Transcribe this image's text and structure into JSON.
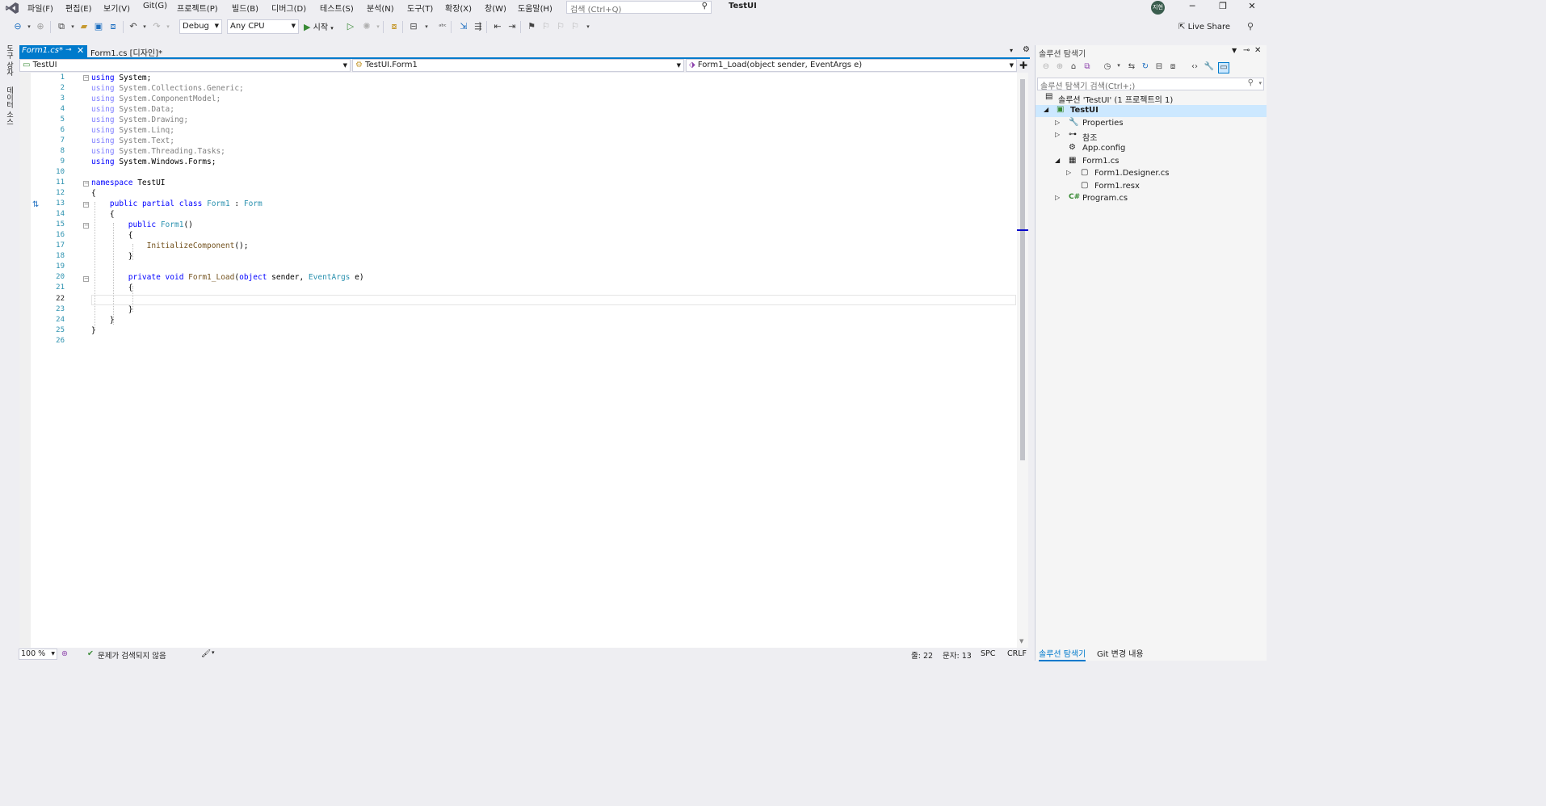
{
  "menubar": {
    "items": [
      "파일(F)",
      "편집(E)",
      "보기(V)",
      "Git(G)",
      "프로젝트(P)",
      "빌드(B)",
      "디버그(D)",
      "테스트(S)",
      "분석(N)",
      "도구(T)",
      "확장(X)",
      "창(W)",
      "도움말(H)"
    ],
    "search_placeholder": "검색 (Ctrl+Q)",
    "window_title": "TestUI",
    "avatar_initials": "지현"
  },
  "toolbar": {
    "config": "Debug",
    "platform": "Any CPU",
    "start_label": "시작",
    "live_share": "Live Share"
  },
  "left_strip": {
    "toolbox": "도구 상자",
    "datasource": "데이터 소스"
  },
  "tabs": [
    {
      "label": "Form1.cs*",
      "active": true
    },
    {
      "label": "Form1.cs [디자인]*",
      "active": false
    }
  ],
  "navbar": {
    "project": "TestUI",
    "type": "TestUI.Form1",
    "member": "Form1_Load(object sender, EventArgs e)"
  },
  "editor": {
    "current_line": 22,
    "line_numbers": [
      "1",
      "2",
      "3",
      "4",
      "5",
      "6",
      "7",
      "8",
      "9",
      "10",
      "11",
      "12",
      "13",
      "14",
      "15",
      "16",
      "17",
      "18",
      "19",
      "20",
      "21",
      "22",
      "23",
      "24",
      "25",
      "26"
    ],
    "lines": [
      "using System;",
      "using System.Collections.Generic;",
      "using System.ComponentModel;",
      "using System.Data;",
      "using System.Drawing;",
      "using System.Linq;",
      "using System.Text;",
      "using System.Threading.Tasks;",
      "using System.Windows.Forms;",
      "",
      "namespace TestUI",
      "{",
      "    public partial class Form1 : Form",
      "    {",
      "        public Form1()",
      "        {",
      "            InitializeComponent();",
      "        }",
      "",
      "        private void Form1_Load(object sender, EventArgs e)",
      "        {",
      "",
      "        }",
      "    }",
      "}",
      ""
    ]
  },
  "statusbar": {
    "zoom": "100 %",
    "issues": "문제가 검색되지 않음",
    "line": "줄: 22",
    "col": "문자: 13",
    "spc": "SPC",
    "eol": "CRLF"
  },
  "solution_explorer": {
    "title": "솔루션 탐색기",
    "search_placeholder": "솔루션 탐색기 검색(Ctrl+;)",
    "tree": [
      {
        "label": "솔루션 'TestUI' (1 프로젝트의 1)",
        "level": 0,
        "icon": "solution-icon",
        "expander": ""
      },
      {
        "label": "TestUI",
        "level": 1,
        "icon": "csproj-icon",
        "expander": "◢",
        "selected": true,
        "bold": true
      },
      {
        "label": "Properties",
        "level": 2,
        "icon": "wrench-icon",
        "expander": "▷"
      },
      {
        "label": "참조",
        "level": 2,
        "icon": "references-icon",
        "expander": "▷"
      },
      {
        "label": "App.config",
        "level": 2,
        "icon": "config-file-icon",
        "expander": ""
      },
      {
        "label": "Form1.cs",
        "level": 2,
        "icon": "form-file-icon",
        "expander": "◢"
      },
      {
        "label": "Form1.Designer.cs",
        "level": 3,
        "icon": "cs-file-icon",
        "expander": "▷"
      },
      {
        "label": "Form1.resx",
        "level": 3,
        "icon": "resx-file-icon",
        "expander": ""
      },
      {
        "label": "Program.cs",
        "level": 2,
        "icon": "csharp-icon",
        "expander": "▷"
      }
    ],
    "bottom_tabs": [
      "솔루션 탐색기",
      "Git 변경 내용"
    ]
  },
  "colors": {
    "accent": "#007acc",
    "keyword": "#0000ff",
    "type": "#2b91af",
    "method": "#74531f",
    "chrome_bg": "#eeeef2"
  }
}
